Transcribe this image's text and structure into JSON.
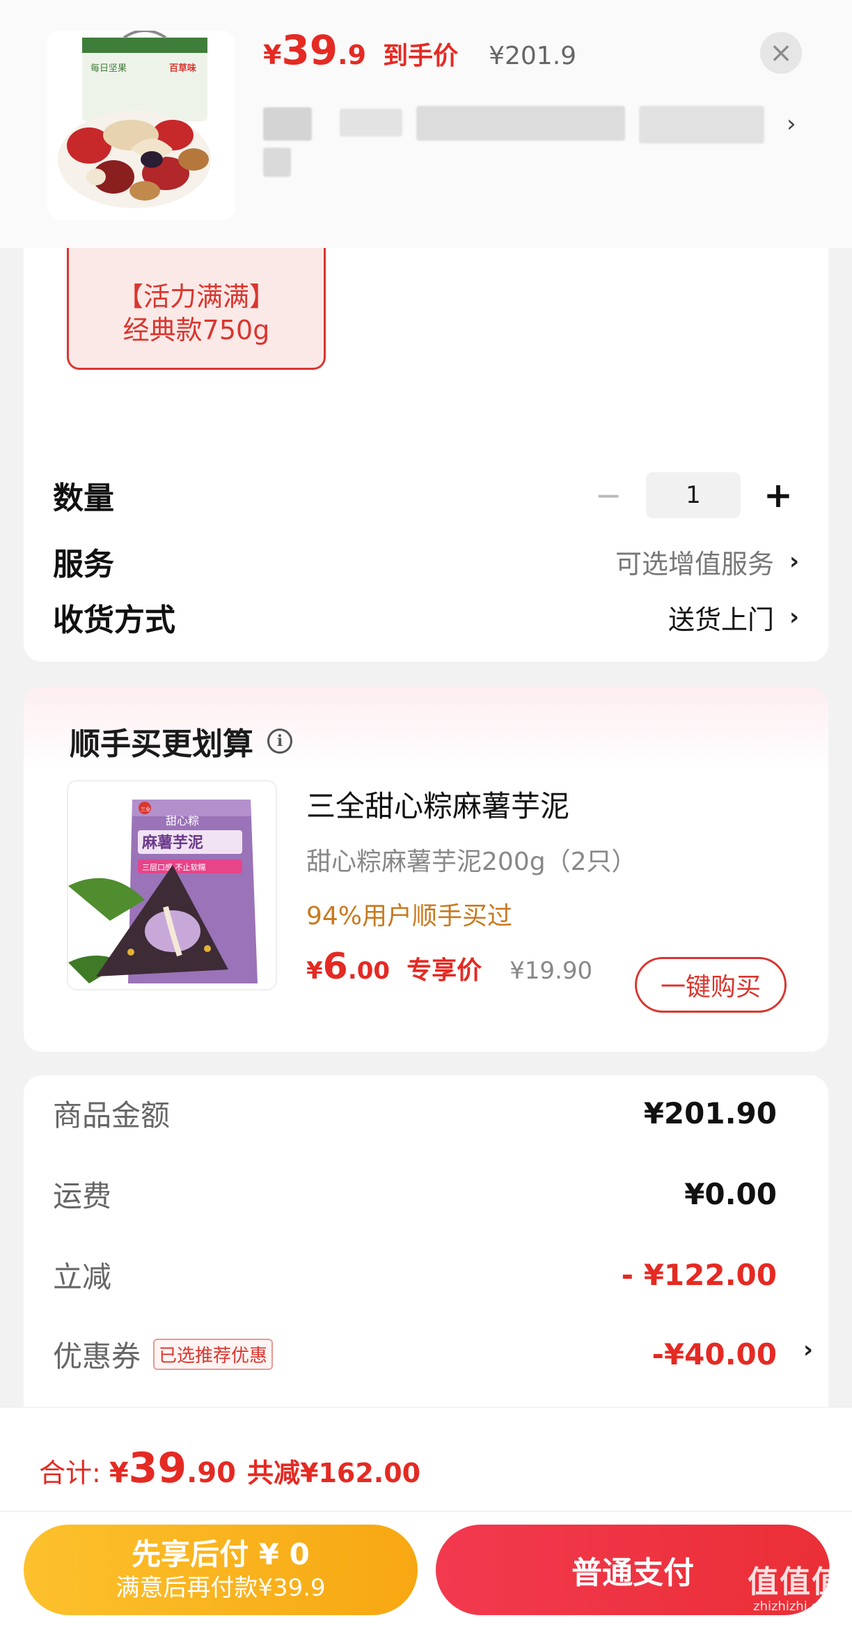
{
  "header": {
    "price_symbol": "¥",
    "price_int": "39",
    "price_dec": ".9",
    "price_tag": "到手价",
    "original_price": "¥201.9",
    "close_icon": "close-icon",
    "chevron_icon": "chevron-right-icon",
    "thumb_brand": "百草味",
    "thumb_label": "每日坚果"
  },
  "spec": {
    "variant_line1": "【活力满满】",
    "variant_line2": "经典款750g",
    "quantity_label": "数量",
    "quantity_value": "1",
    "minus_symbol": "−",
    "plus_symbol": "+",
    "service_label": "服务",
    "service_value": "可选增值服务",
    "delivery_label": "收货方式",
    "delivery_value": "送货上门",
    "chevron": "›"
  },
  "upsell": {
    "title": "顺手买更划算",
    "info_symbol": "i",
    "product_name": "三全甜心粽麻薯芋泥",
    "product_spec": "甜心粽麻薯芋泥200g（2只）",
    "buy_rate": "94%用户顺手买过",
    "price_symbol": "¥",
    "price_int": "6",
    "price_dec": ".00",
    "price_tag": "专享价",
    "original_price": "¥19.90",
    "buy_button": "一键购买",
    "pack_brand": "三全",
    "pack_line1": "甜心粽",
    "pack_line2": "麻薯芋泥",
    "pack_band": "三层口感 不止软糯"
  },
  "summary": {
    "goods_label": "商品金额",
    "goods_value": "¥201.90",
    "shipping_label": "运费",
    "shipping_value": "¥0.00",
    "discount_label": "立减",
    "discount_value": "- ¥122.00",
    "coupon_label": "优惠券",
    "coupon_badge": "已选推荐优惠",
    "coupon_value": "-¥40.00",
    "chevron": "›"
  },
  "bottom": {
    "total_label": "合计:",
    "total_symbol": "¥",
    "total_int": "39",
    "total_dec": ".90",
    "total_saved": "共减¥162.00",
    "pay_later_line1": "先享后付 ¥ 0",
    "pay_later_line2": "满意后再付款¥39.9",
    "pay_now": "普通支付"
  },
  "watermark": {
    "line1": "值值值",
    "line2": "zhizhizhi.com"
  },
  "colors": {
    "accent_red": "#e42a23",
    "coupon_gold": "#f7a711",
    "pay_red": "#ea2f36",
    "buy_rate_orange": "#c8791f"
  }
}
